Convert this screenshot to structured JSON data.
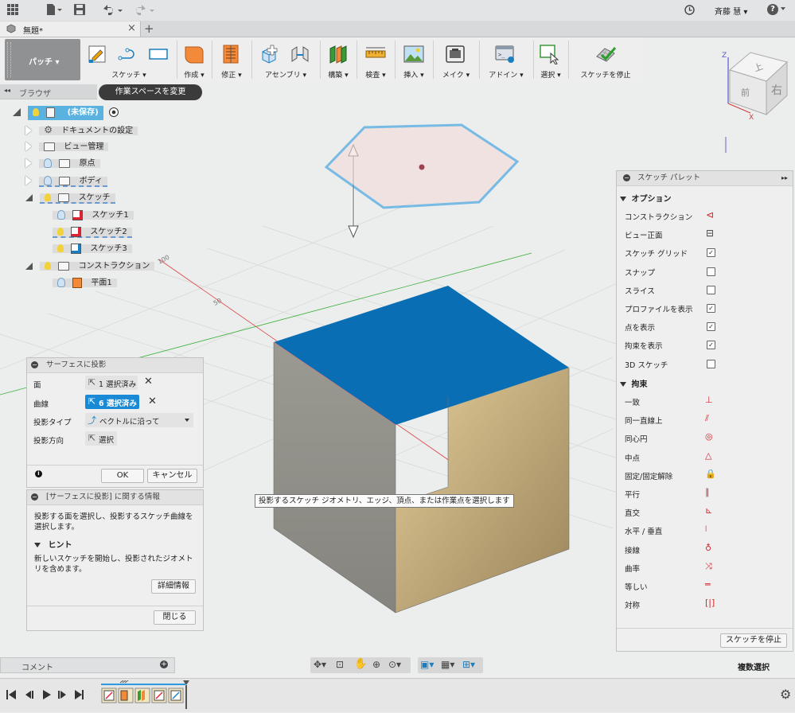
{
  "header": {
    "user": "斉藤 慧 ▾",
    "help": "?"
  },
  "tab": {
    "title": "無題*",
    "close": "×",
    "add": "+"
  },
  "workspace": {
    "label": "パッチ ▾",
    "tooltip": "作業スペースを変更"
  },
  "toolbar": [
    {
      "label": "スケッチ ▾"
    },
    {
      "label": "作成 ▾"
    },
    {
      "label": "修正 ▾"
    },
    {
      "label": "アセンブリ ▾"
    },
    {
      "label": "構築 ▾"
    },
    {
      "label": "検査 ▾"
    },
    {
      "label": "挿入 ▾"
    },
    {
      "label": "メイク ▾"
    },
    {
      "label": "アドイン ▾"
    },
    {
      "label": "選択 ▾"
    },
    {
      "label": "スケッチを停止"
    }
  ],
  "viewcube": {
    "top": "上",
    "front": "前",
    "right": "右",
    "axis_z": "Z",
    "axis_x": "X"
  },
  "browser": {
    "title": "ブラウザ",
    "items": [
      {
        "label": "(未保存)"
      },
      {
        "label": "ドキュメントの設定"
      },
      {
        "label": "ビュー管理"
      },
      {
        "label": "原点"
      },
      {
        "label": "ボディ"
      },
      {
        "label": "スケッチ"
      },
      {
        "label": "スケッチ1"
      },
      {
        "label": "スケッチ2"
      },
      {
        "label": "スケッチ3"
      },
      {
        "label": "コンストラクション"
      },
      {
        "label": "平面1"
      }
    ]
  },
  "grid_labels": {
    "g100": "100",
    "g50": "50"
  },
  "project_dialog": {
    "title": "サーフェスに投影",
    "face_label": "面",
    "face_value": "1 選択済み",
    "curve_label": "曲線",
    "curve_value": "6 選択済み",
    "type_label": "投影タイプ",
    "type_value": "ベクトルに沿って",
    "dir_label": "投影方向",
    "dir_value": "選択",
    "ok": "OK",
    "cancel": "キャンセル"
  },
  "info_panel": {
    "title": "[サーフェスに投影] に関する情報",
    "body": "投影する面を選択し、投影するスケッチ曲線を選択します。",
    "hint_title": "ヒント",
    "hint_body": "新しいスケッチを開始し、投影されたジオメトリを含めます。",
    "more": "詳細情報",
    "close": "閉じる"
  },
  "tooltip_main": "投影するスケッチ ジオメトリ、エッジ、頂点、または作業点を選択します",
  "palette": {
    "title": "スケッチ パレット",
    "options_title": "オプション",
    "options": [
      {
        "label": "コンストラクション",
        "icon": "construction-icon"
      },
      {
        "label": "ビュー正面",
        "icon": "look-at-icon"
      },
      {
        "label": "スケッチ グリッド",
        "checked": true
      },
      {
        "label": "スナップ",
        "checked": false
      },
      {
        "label": "スライス",
        "checked": false
      },
      {
        "label": "プロファイルを表示",
        "checked": true
      },
      {
        "label": "点を表示",
        "checked": true
      },
      {
        "label": "拘束を表示",
        "checked": true
      },
      {
        "label": "3D スケッチ",
        "checked": false
      }
    ],
    "constraints_title": "拘束",
    "constraints": [
      {
        "label": "一致",
        "icon": "coincident-icon"
      },
      {
        "label": "同一直線上",
        "icon": "collinear-icon"
      },
      {
        "label": "同心円",
        "icon": "concentric-icon"
      },
      {
        "label": "中点",
        "icon": "midpoint-icon"
      },
      {
        "label": "固定/固定解除",
        "icon": "fix-icon"
      },
      {
        "label": "平行",
        "icon": "parallel-icon"
      },
      {
        "label": "直交",
        "icon": "perpendicular-icon"
      },
      {
        "label": "水平 / 垂直",
        "icon": "horizontal-vertical-icon"
      },
      {
        "label": "接線",
        "icon": "tangent-icon"
      },
      {
        "label": "曲率",
        "icon": "curvature-icon"
      },
      {
        "label": "等しい",
        "icon": "equal-icon"
      },
      {
        "label": "対称",
        "icon": "symmetry-icon"
      }
    ],
    "stop": "スケッチを停止"
  },
  "comment": "コメント",
  "multi_select": "複数選択",
  "colors": {
    "accent": "#1a7fc1",
    "face_blue": "#0a6eb4",
    "sketch_blue": "#2a9be0",
    "constraint_red": "#d2262b"
  }
}
